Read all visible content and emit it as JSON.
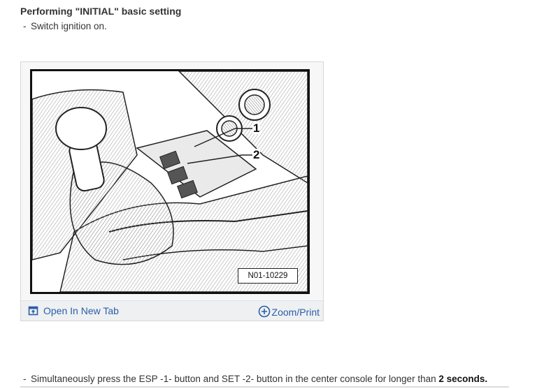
{
  "section": {
    "title": "Performing \"INITIAL\" basic setting"
  },
  "steps": [
    {
      "dash": "-",
      "text": "Switch ignition on."
    },
    {
      "dash": "-",
      "text": "Simultaneously press the ESP -1- button and SET -2- button in the center console for longer than ",
      "bold": "2 seconds."
    }
  ],
  "figure": {
    "code": "N01-10229",
    "callouts": [
      "1",
      "2"
    ],
    "open_label": "Open In New Tab",
    "zoom_label": "Zoom/Print",
    "open_icon": "open-new-tab-icon",
    "zoom_icon": "zoom-plus-icon",
    "link_color": "#2a5ea8"
  }
}
